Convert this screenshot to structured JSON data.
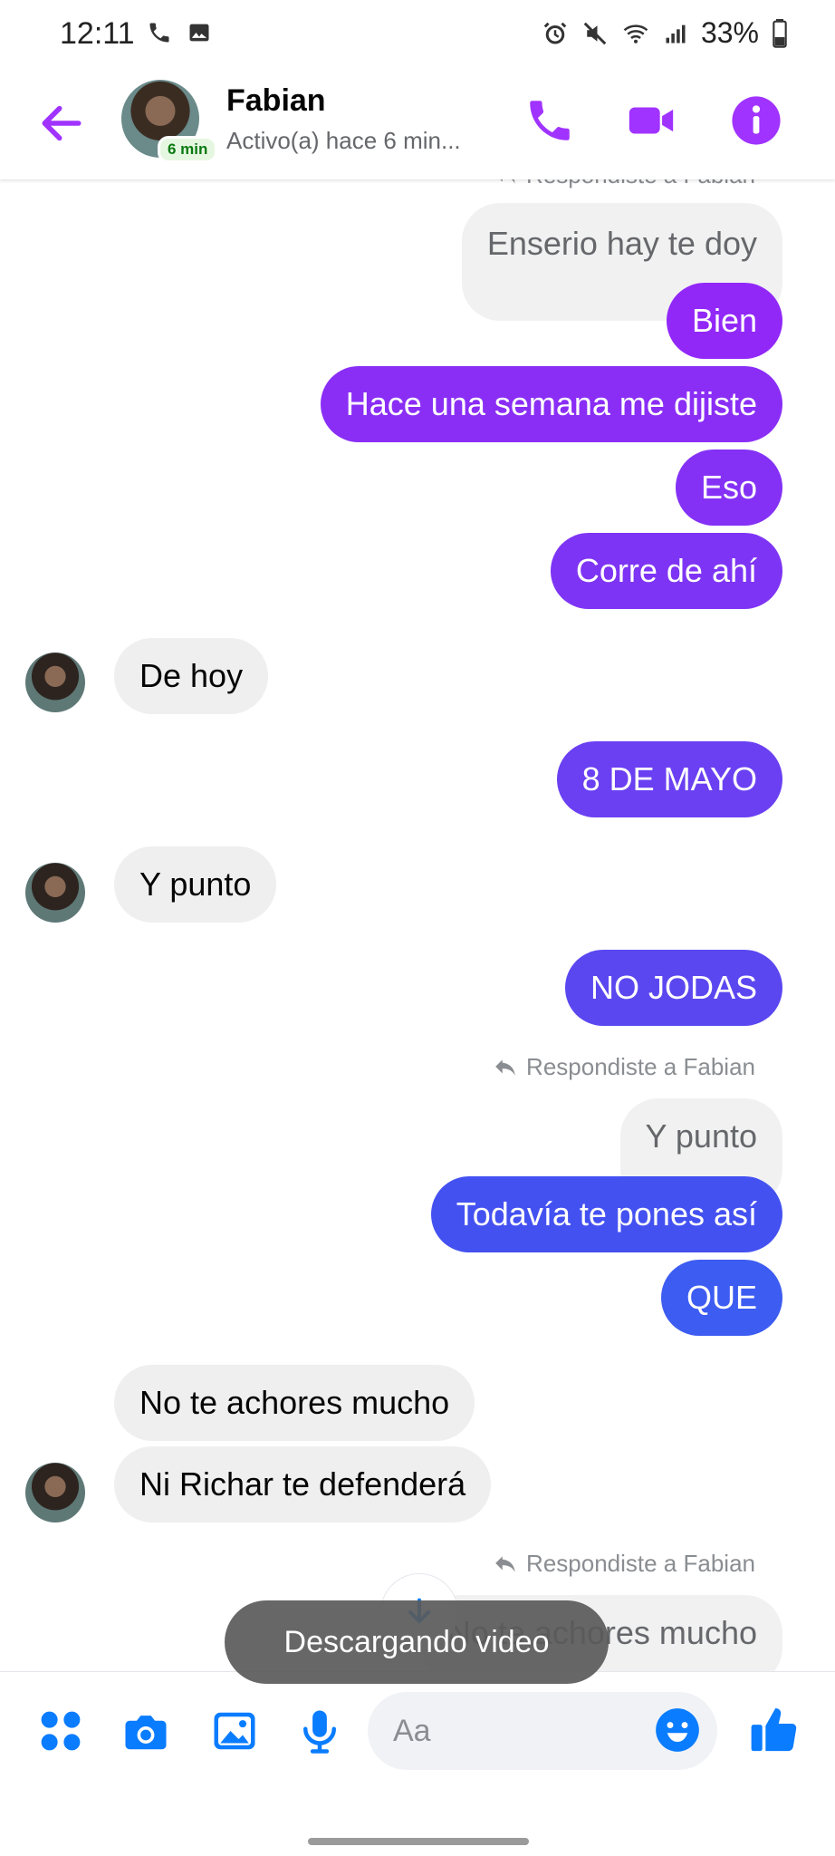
{
  "status_bar": {
    "time": "12:11",
    "battery": "33%"
  },
  "header": {
    "contact_name": "Fabian",
    "presence_badge": "6 min",
    "status": "Activo(a) hace 6 min..."
  },
  "messages": {
    "top_reply_label": "Respondiste a Fabian",
    "m1": "Enserio hay te doy",
    "m2": "Bien",
    "m3": "Hace una semana me dijiste",
    "m4": "Eso",
    "m5": "Corre de ahí",
    "m6": "De hoy",
    "m7": "8 DE MAYO",
    "m8": "Y punto",
    "m9": "NO JODAS",
    "reply_label_1": "Respondiste a Fabian",
    "m10_quote": "Y punto",
    "m11": "Todavía te pones así",
    "m12": "QUE",
    "m13": "No te achores mucho",
    "m14": "Ni Richar te defenderá",
    "reply_label_2": "Respondiste a Fabian",
    "m15_quote": "No te achores mucho"
  },
  "toast": {
    "text": "Descargando video"
  },
  "composer": {
    "placeholder": "Aa"
  },
  "colors": {
    "accent": "#a033ff",
    "out_purple": "#8d2cf5",
    "out_violet": "#6f3ef0",
    "out_blue": "#3d5af1",
    "icon_blue": "#0a7cff"
  }
}
